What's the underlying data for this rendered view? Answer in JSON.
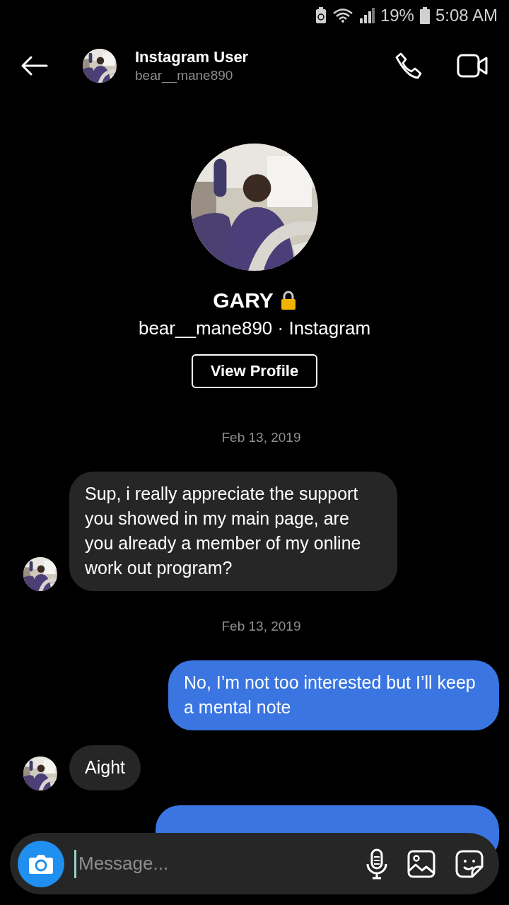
{
  "status_bar": {
    "battery_percent": "19%",
    "time": "5:08 AM"
  },
  "header": {
    "title": "Instagram User",
    "subtitle": "bear__mane890"
  },
  "profile": {
    "name": "GARY",
    "locked": true,
    "handle": "bear__mane890 · Instagram",
    "button": "View Profile"
  },
  "messages": [
    {
      "kind": "date",
      "text": "Feb 13, 2019"
    },
    {
      "kind": "incoming",
      "text": "Sup, i really appreciate the support you showed in my main page, are you already a member of my online work out program?"
    },
    {
      "kind": "date",
      "text": "Feb 13, 2019"
    },
    {
      "kind": "outgoing",
      "text": "No, I’m not too interested but I’ll keep a mental note"
    },
    {
      "kind": "incoming",
      "text": "Aight"
    },
    {
      "kind": "outgoing_hidden"
    }
  ],
  "composer": {
    "placeholder": "Message..."
  }
}
